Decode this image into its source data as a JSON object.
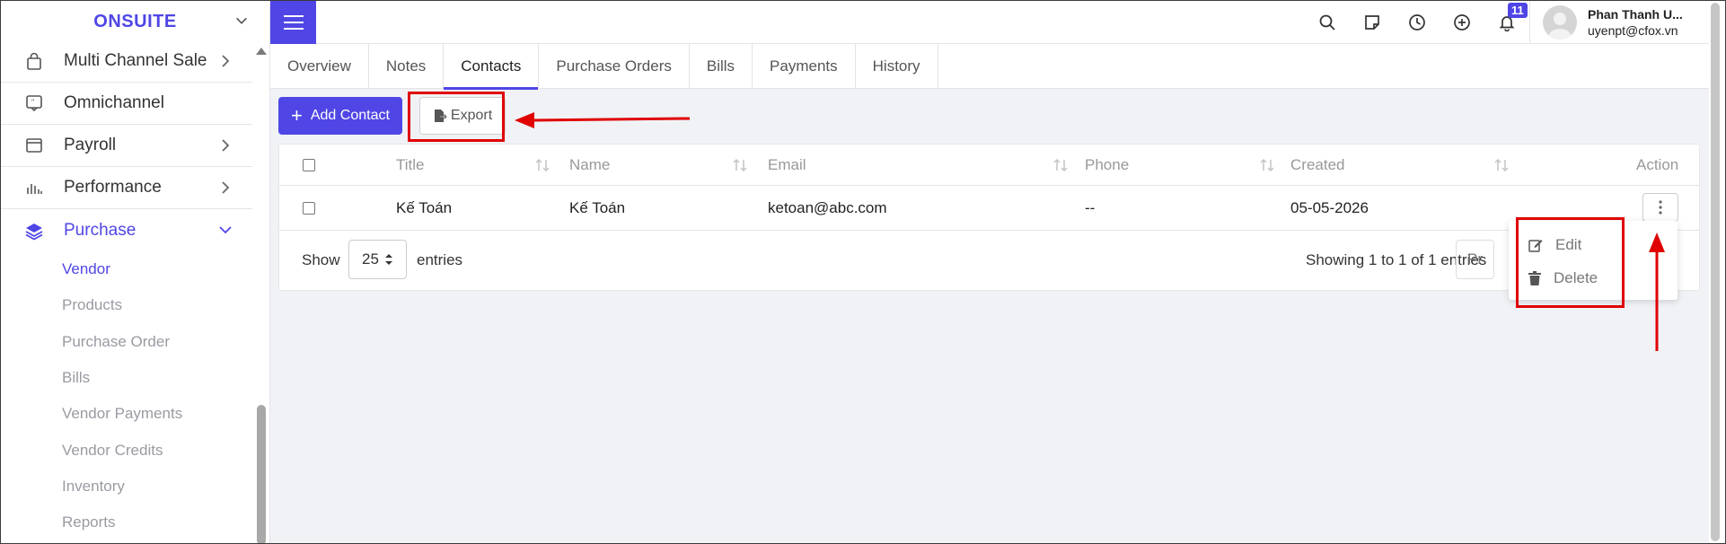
{
  "brand": {
    "name": "ONSUITE"
  },
  "sidebar": {
    "items": [
      {
        "label": "Multi Channel Sale",
        "icon": "shopping-bag-icon",
        "has_arrow": true
      },
      {
        "label": "Omnichannel",
        "icon": "chat-bubble-icon",
        "has_arrow": false
      },
      {
        "label": "Payroll",
        "icon": "window-icon",
        "has_arrow": true
      },
      {
        "label": "Performance",
        "icon": "bar-chart-icon",
        "has_arrow": true
      },
      {
        "label": "Purchase",
        "icon": "layers-icon",
        "has_arrow": true,
        "expanded": true
      }
    ],
    "submenu": [
      {
        "label": "Vendor",
        "active": true
      },
      {
        "label": "Products"
      },
      {
        "label": "Purchase Order"
      },
      {
        "label": "Bills"
      },
      {
        "label": "Vendor Payments"
      },
      {
        "label": "Vendor Credits"
      },
      {
        "label": "Inventory"
      },
      {
        "label": "Reports"
      }
    ]
  },
  "topbar": {
    "notification_count": "11",
    "user_name": "Phan Thanh U...",
    "user_email": "uyenpt@cfox.vn",
    "icons": [
      "search-icon",
      "note-icon",
      "clock-icon",
      "plus-circle-icon",
      "bell-icon"
    ]
  },
  "tabs": [
    "Overview",
    "Notes",
    "Contacts",
    "Purchase Orders",
    "Bills",
    "Payments",
    "History"
  ],
  "active_tab": "Contacts",
  "actions": {
    "add_label": "Add Contact",
    "export_label": "Export"
  },
  "table": {
    "headers": {
      "title": "Title",
      "name": "Name",
      "email": "Email",
      "phone": "Phone",
      "created": "Created",
      "action": "Action"
    },
    "rows": [
      {
        "title": "Kế Toán",
        "name": "Kế Toán",
        "email": "ketoan@abc.com",
        "phone": "--",
        "created": "05-05-2026"
      }
    ]
  },
  "footer": {
    "show_label": "Show",
    "page_size": "25",
    "entries_label": "entries",
    "showing_text": "Showing 1 to 1 of 1 entries",
    "prev_label": "Pr"
  },
  "dropdown": {
    "edit_label": "Edit",
    "delete_label": "Delete"
  },
  "colors": {
    "accent": "#4f46e5",
    "highlight": "#e00000"
  }
}
